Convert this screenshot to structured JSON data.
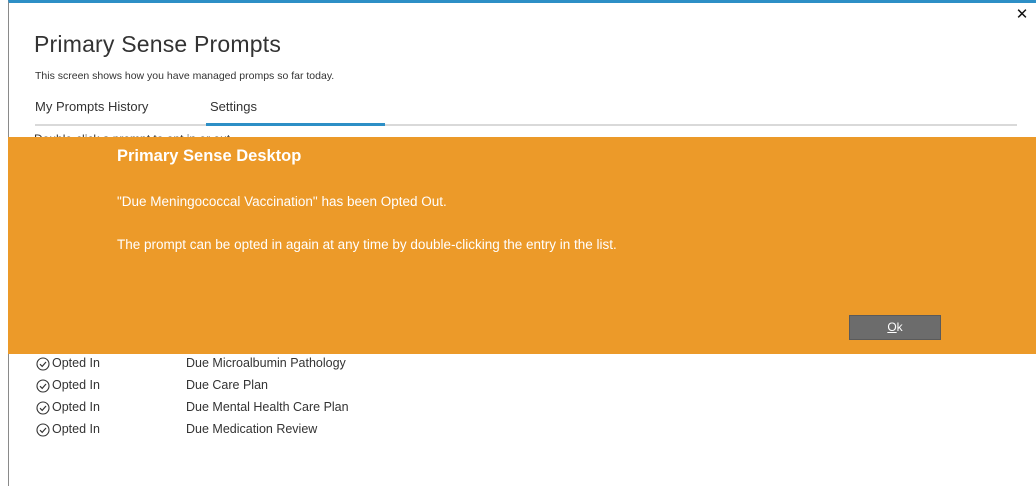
{
  "window": {
    "title": "Primary Sense Prompts",
    "subtitle": "This screen shows how you have managed promps so far today.",
    "close_glyph": "✕",
    "accent_color": "#2d8fc6"
  },
  "tabs": [
    {
      "label": "My Prompts History",
      "active": false
    },
    {
      "label": "Settings",
      "active": true
    }
  ],
  "partially_hidden_text": "Double-click a prompt to opt in or out",
  "list": [
    {
      "status": "Opted In",
      "icon": "check-circle-icon",
      "name": "Due Microalbumin Pathology"
    },
    {
      "status": "Opted In",
      "icon": "check-circle-icon",
      "name": "Due Care Plan"
    },
    {
      "status": "Opted In",
      "icon": "check-circle-icon",
      "name": "Due Mental Health Care Plan"
    },
    {
      "status": "Opted In",
      "icon": "check-circle-icon",
      "name": "Due Medication Review"
    }
  ],
  "dialog": {
    "title": "Primary Sense Desktop",
    "message1": "\"Due Meningococcal Vaccination\" has been Opted Out.",
    "message2": "The prompt can be opted in again at any time by double-clicking the entry in the list.",
    "ok_accel": "O",
    "ok_rest": "k",
    "background_color": "#ec9a29",
    "button_color": "#6c6c6c"
  }
}
